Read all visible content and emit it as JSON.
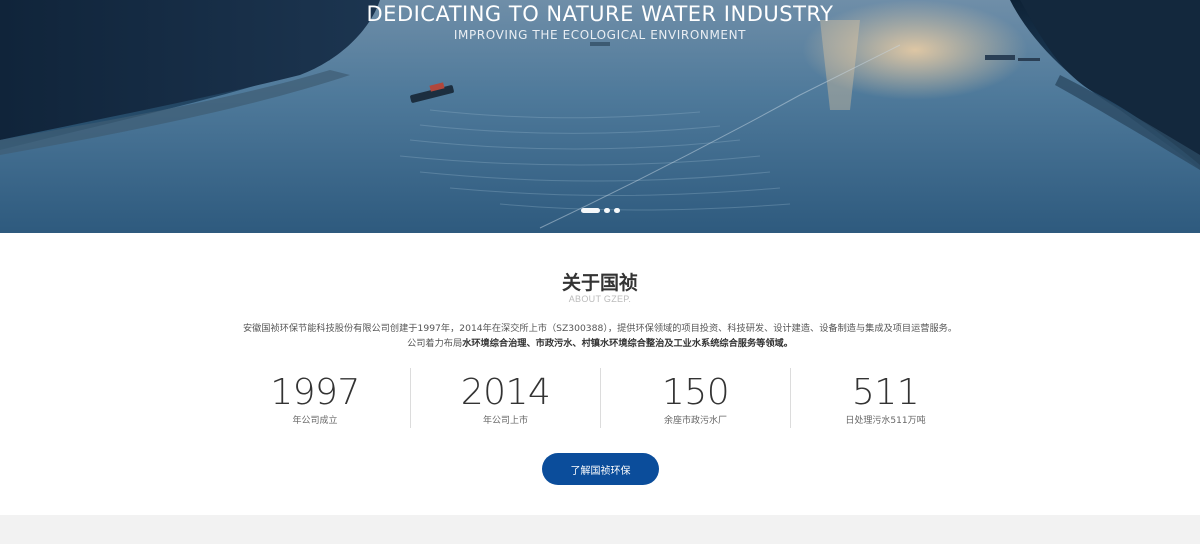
{
  "hero": {
    "title": "DEDICATING TO NATURE WATER INDUSTRY",
    "subtitle": "IMPROVING THE ECOLOGICAL ENVIRONMENT",
    "carousel": {
      "total": 3,
      "active_index": 1
    }
  },
  "about": {
    "title": "关于国祯",
    "subtitle": "ABOUT GZEP.",
    "desc_line1": "安徽国祯环保节能科技股份有限公司创建于1997年，2014年在深交所上市（SZ300388），提供环保领域的项目投资、科技研发、设计建造、设备制造与集成及项目运营服务。",
    "desc_line2_prefix": "公司着力布局",
    "desc_line2_bold": "水环境综合治理、市政污水、村镇水环境综合整治及工业水系统综合服务等领域。",
    "stats": [
      {
        "number": "1997",
        "label": "年公司成立"
      },
      {
        "number": "2014",
        "label": "年公司上市"
      },
      {
        "number": "150",
        "label": "余座市政污水厂"
      },
      {
        "number": "511",
        "label": "日处理污水511万吨"
      }
    ],
    "button_label": "了解国祯环保"
  },
  "colors": {
    "accent": "#0b4d9b",
    "divider": "#dcdcdc",
    "footer_band": "#f2f2f2"
  }
}
